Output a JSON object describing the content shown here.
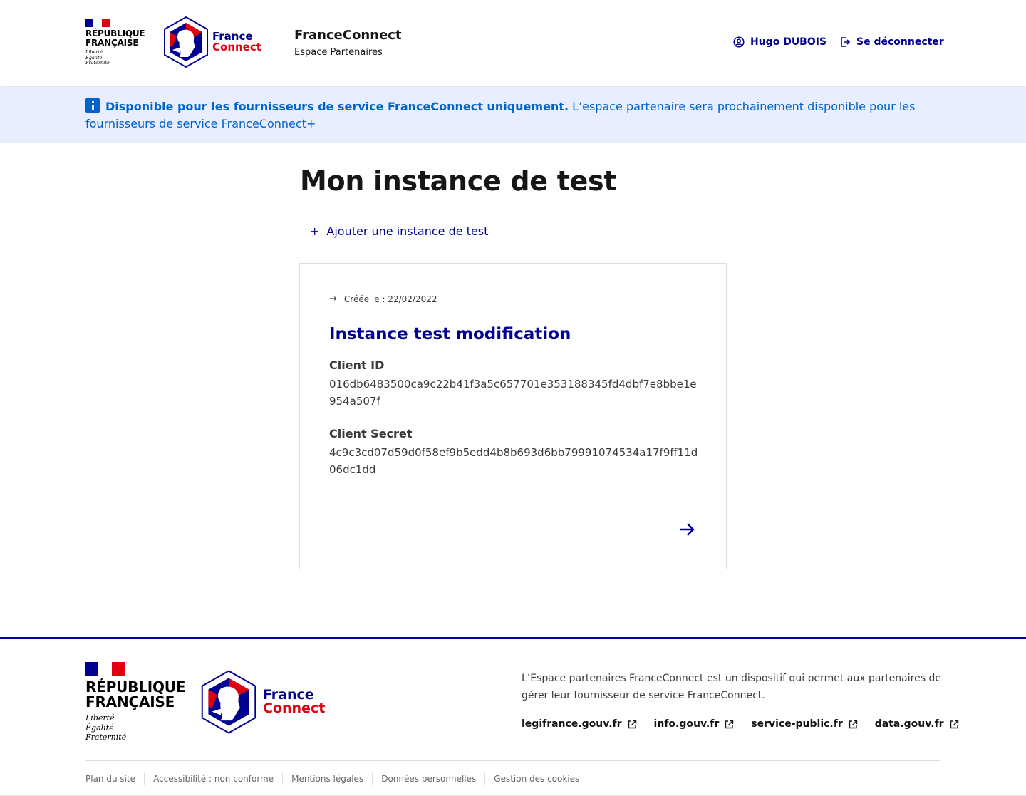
{
  "colors": {
    "blue_france": "#000091",
    "red_marianne": "#e1000f",
    "info_blue": "#0063cb",
    "notice_bg": "#e8edff"
  },
  "header": {
    "rf_name": "RÉPUBLIQUE FRANÇAISE",
    "rf_motto_1": "Liberté",
    "rf_motto_2": "Égalité",
    "rf_motto_3": "Fraternité",
    "fc_logo_france": "France",
    "fc_logo_connect": "Connect",
    "service_title": "FranceConnect",
    "service_tagline": "Espace Partenaires",
    "user_label": "Hugo DUBOIS",
    "user_icon": "account-circle-icon",
    "logout_label": "Se déconnecter",
    "logout_icon": "logout-box-icon"
  },
  "notice": {
    "icon": "info-icon",
    "strong": "Disponible pour les fournisseurs de service FranceConnect uniquement.",
    "text": " L’espace partenaire sera prochainement disponible pour les fournisseurs de service FranceConnect+"
  },
  "main": {
    "title": "Mon instance de test",
    "add_label": "Ajouter une instance de test",
    "add_icon": "plus-icon",
    "card": {
      "detail_icon": "arrow-right-icon",
      "detail": "Créée le : 22/02/2022",
      "title": "Instance test modification",
      "client_id_label": "Client ID",
      "client_id": "016db6483500ca9c22b41f3a5c657701e353188345fd4dbf7e8bbe1e954a507f",
      "client_secret_label": "Client Secret",
      "client_secret": "4c9c3cd07d59d0f58ef9b5edd4b8b693d6bb79991074534a17f9ff11d06dc1dd",
      "open_icon": "arrow-right-icon"
    }
  },
  "footer": {
    "rf_name_line1": "RÉPUBLIQUE",
    "rf_name_line2": "FRANÇAISE",
    "rf_motto_1": "Liberté",
    "rf_motto_2": "Égalité",
    "rf_motto_3": "Fraternité",
    "fc_logo_france": "France",
    "fc_logo_connect": "Connect",
    "description": "L’Espace partenaires FranceConnect est un dispositif qui permet aux partenaires de gérer leur fournisseur de service FranceConnect.",
    "links": [
      "legifrance.gouv.fr",
      "info.gouv.fr",
      "service-public.fr",
      "data.gouv.fr"
    ],
    "external_icon": "external-link-icon",
    "bottom_links": [
      "Plan du site",
      "Accessibilité : non conforme",
      "Mentions légales",
      "Données personnelles",
      "Gestion des cookies"
    ]
  }
}
